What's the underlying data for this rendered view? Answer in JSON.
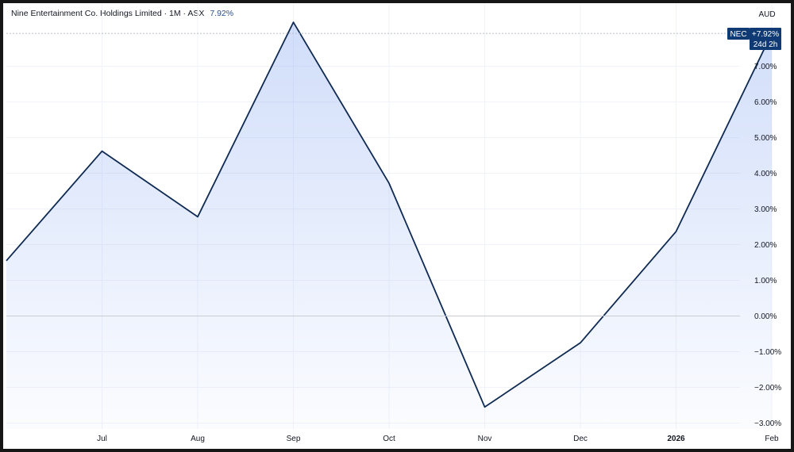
{
  "header": {
    "name": "Nine Entertainment Co. Holdings Limited",
    "interval": "1M",
    "exchange": "ASX",
    "change": "7.92%"
  },
  "currency": "AUD",
  "badge": {
    "symbol": "NEC",
    "change": "+7.92%",
    "countdown": "24d 2h"
  },
  "colors": {
    "line": "#0f2a52",
    "fill": "#7b9ff0",
    "badge": "#0f3a73",
    "grid": "#f0f3fa"
  },
  "chart_data": {
    "type": "area",
    "x": [
      "Jun 2025",
      "Jul 2025",
      "Aug 2025",
      "Sep 2025",
      "Oct 2025",
      "Nov 2025",
      "Dec 2025",
      "Jan 2026",
      "Feb 2026"
    ],
    "values": [
      1.55,
      4.62,
      2.78,
      8.23,
      3.72,
      -2.55,
      -0.75,
      2.37,
      7.92
    ],
    "x_tick_labels": [
      "Jul",
      "Aug",
      "Sep",
      "Oct",
      "Nov",
      "Dec",
      "2026",
      "Feb"
    ],
    "y_tick_labels": [
      "7.00%",
      "6.00%",
      "5.00%",
      "4.00%",
      "3.00%",
      "2.00%",
      "1.00%",
      "0.00%",
      "−1.00%",
      "−2.00%",
      "−3.00%"
    ],
    "y_ticks": [
      7,
      6,
      5,
      4,
      3,
      2,
      1,
      0,
      -1,
      -2,
      -3
    ],
    "ylim": [
      -3.3,
      8.5
    ],
    "unit": "%",
    "grid": true
  }
}
